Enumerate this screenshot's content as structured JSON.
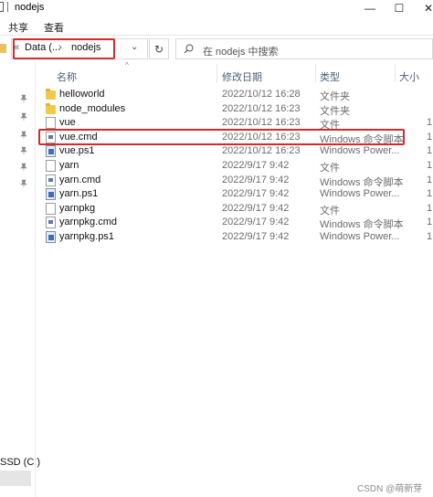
{
  "window": {
    "title": "nodejs",
    "min_glyph": "—",
    "max_glyph": "☐",
    "close_glyph": "✕"
  },
  "ribbon": {
    "tabs": [
      {
        "label": "共享"
      },
      {
        "label": "查看"
      }
    ]
  },
  "address": {
    "lead": "«",
    "crumb_parent": "Data (...",
    "separator": "›",
    "crumb_current": "nodejs",
    "dropdown_glyph": "⌄",
    "refresh_glyph": "↻"
  },
  "search": {
    "placeholder": "在 nodejs 中搜索"
  },
  "nav": {
    "drive_label": "SSD (C:)"
  },
  "columns": {
    "name": "名称",
    "date": "修改日期",
    "type": "类型",
    "size": "大小",
    "sort_caret": "^"
  },
  "files": [
    {
      "name": "helloworld",
      "date": "2022/10/12 16:28",
      "type": "文件夹",
      "icon": "folder-icon"
    },
    {
      "name": "node_modules",
      "date": "2022/10/12 16:23",
      "type": "文件夹",
      "icon": "folder-icon"
    },
    {
      "name": "vue",
      "date": "2022/10/12 16:23",
      "type": "文件",
      "icon": "file-icon"
    },
    {
      "name": "vue.cmd",
      "date": "2022/10/12 16:23",
      "type": "Windows 命令脚本",
      "icon": "cmd-icon"
    },
    {
      "name": "vue.ps1",
      "date": "2022/10/12 16:23",
      "type": "Windows Power...",
      "icon": "powershell-icon"
    },
    {
      "name": "yarn",
      "date": "2022/9/17 9:42",
      "type": "文件",
      "icon": "file-icon"
    },
    {
      "name": "yarn.cmd",
      "date": "2022/9/17 9:42",
      "type": "Windows 命令脚本",
      "icon": "cmd-icon"
    },
    {
      "name": "yarn.ps1",
      "date": "2022/9/17 9:42",
      "type": "Windows Power...",
      "icon": "powershell-icon"
    },
    {
      "name": "yarnpkg",
      "date": "2022/9/17 9:42",
      "type": "文件",
      "icon": "file-icon"
    },
    {
      "name": "yarnpkg.cmd",
      "date": "2022/9/17 9:42",
      "type": "Windows 命令脚本",
      "icon": "cmd-icon"
    },
    {
      "name": "yarnpkg.ps1",
      "date": "2022/9/17 9:42",
      "type": "Windows Power...",
      "icon": "powershell-icon"
    }
  ],
  "size_tick": "1",
  "watermark": "CSDN @萌新芽",
  "colors": {
    "highlight": "#d62a2a",
    "folder": "#f2c94c",
    "column_text": "#4c607a"
  }
}
